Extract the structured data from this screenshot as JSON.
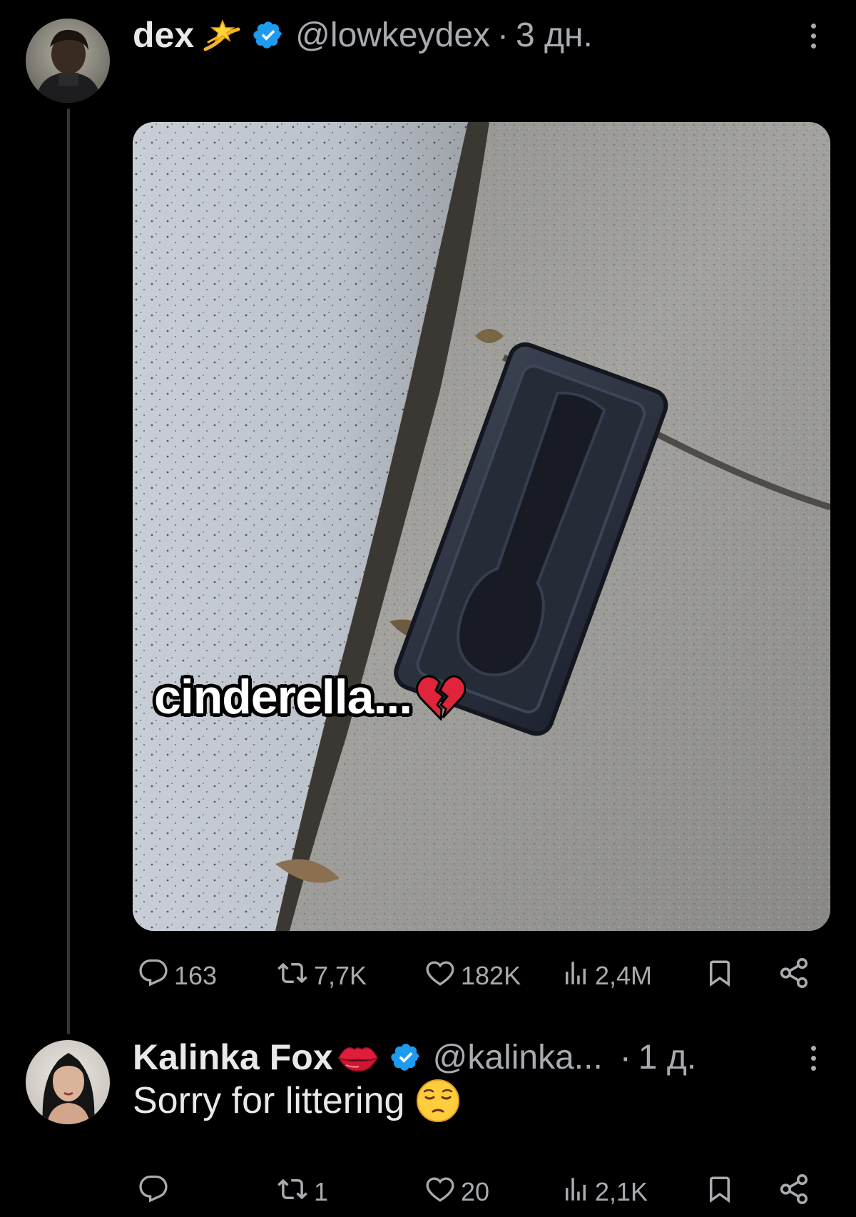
{
  "tweet": {
    "author": {
      "display_name": "dex",
      "name_emoji": "dizzy-emoji",
      "handle": "@lowkeydex",
      "separator": "·",
      "time": "3 дн.",
      "verified": true
    },
    "media": {
      "caption": "cinderella...",
      "caption_emoji": "broken-heart-emoji"
    },
    "actions": {
      "replies": "163",
      "reposts": "7,7K",
      "likes": "182K",
      "views": "2,4M"
    }
  },
  "reply": {
    "author": {
      "display_name": "Kalinka Fox",
      "name_emoji": "lips-emoji",
      "handle": "@kalinka...",
      "separator": "·",
      "time": "1 д.",
      "verified": true
    },
    "text": "Sorry for littering",
    "text_emoji": "pensive-face-emoji",
    "actions": {
      "replies": "",
      "reposts": "1",
      "likes": "20",
      "views": "2,1K"
    }
  },
  "colors": {
    "background": "#000000",
    "primary_text": "#e7e9ea",
    "secondary_text": "#a8abaf",
    "verified_blue": "#1d9bf0",
    "thread_line": "#333639"
  }
}
